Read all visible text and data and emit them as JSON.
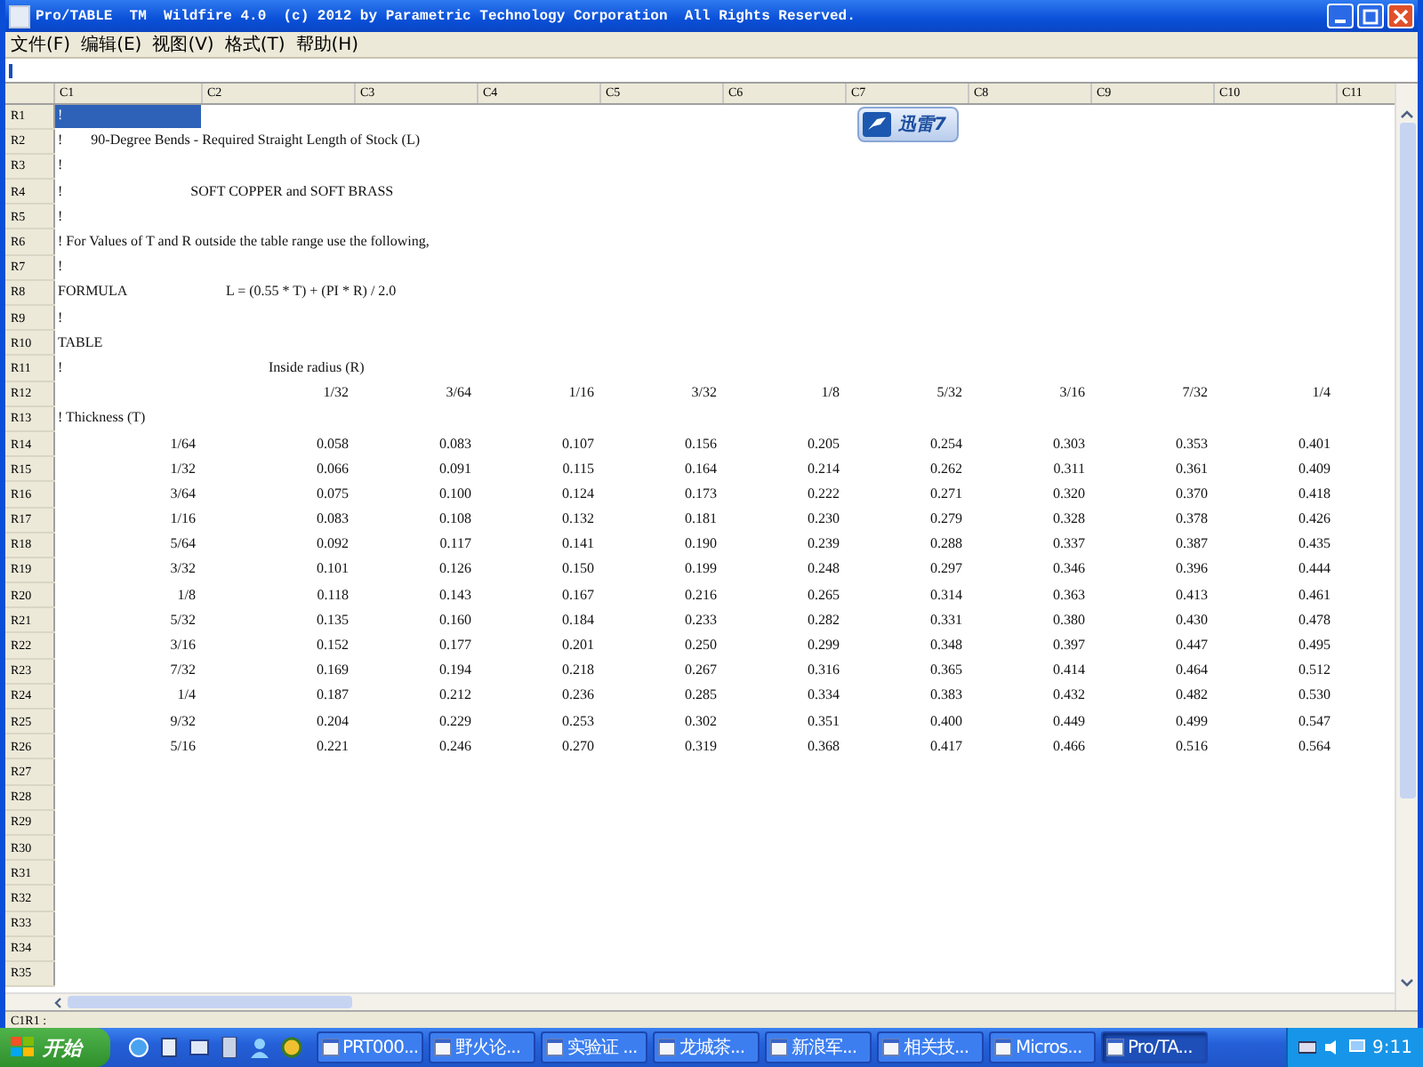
{
  "window": {
    "title": "Pro/TABLE  TM  Wildfire 4.0  (c) 2012 by Parametric Technology Corporation  All Rights Reserved."
  },
  "menu": [
    "文件(F)",
    "编辑(E)",
    "视图(V)",
    "格式(T)",
    "帮助(H)"
  ],
  "table": {
    "columns": [
      "C1",
      "C2",
      "C3",
      "C4",
      "C5",
      "C6",
      "C7",
      "C8",
      "C9",
      "C10",
      "C11"
    ],
    "rows": [
      {
        "label": "R1",
        "kind": "text",
        "selected": true,
        "cells": [
          "!"
        ]
      },
      {
        "label": "R2",
        "kind": "text",
        "selected": false,
        "cells": [
          "!        90-Degree Bends - Required Straight Length of Stock (L)"
        ]
      },
      {
        "label": "R3",
        "kind": "text",
        "selected": false,
        "cells": [
          "!"
        ]
      },
      {
        "label": "R4",
        "kind": "text",
        "selected": false,
        "cells": [
          "!                                    SOFT COPPER and SOFT BRASS"
        ]
      },
      {
        "label": "R5",
        "kind": "text",
        "selected": false,
        "cells": [
          "!"
        ]
      },
      {
        "label": "R6",
        "kind": "text",
        "selected": false,
        "cells": [
          "! For Values of T and R outside the table range use the following,"
        ]
      },
      {
        "label": "R7",
        "kind": "text",
        "selected": false,
        "cells": [
          "!"
        ]
      },
      {
        "label": "R8",
        "kind": "text",
        "selected": false,
        "cells": [
          "FORMULA",
          "      L = (0.55 * T) + (PI * R) / 2.0"
        ]
      },
      {
        "label": "R9",
        "kind": "text",
        "selected": false,
        "cells": [
          "!"
        ]
      },
      {
        "label": "R10",
        "kind": "text",
        "selected": false,
        "cells": [
          "TABLE"
        ]
      },
      {
        "label": "R11",
        "kind": "text",
        "selected": false,
        "cells": [
          "!",
          "                  Inside radius (R)"
        ]
      },
      {
        "label": "R12",
        "kind": "header",
        "selected": false,
        "cells": [
          "1/32",
          "3/64",
          "1/16",
          "3/32",
          "1/8",
          "5/32",
          "3/16",
          "7/32",
          "1/4"
        ]
      },
      {
        "label": "R13",
        "kind": "text",
        "selected": false,
        "cells": [
          "! Thickness (T)"
        ]
      },
      {
        "label": "R14",
        "kind": "data",
        "selected": false,
        "cells": [
          "1/64",
          "0.058",
          "0.083",
          "0.107",
          "0.156",
          "0.205",
          "0.254",
          "0.303",
          "0.353",
          "0.401"
        ]
      },
      {
        "label": "R15",
        "kind": "data",
        "selected": false,
        "cells": [
          "1/32",
          "0.066",
          "0.091",
          "0.115",
          "0.164",
          "0.214",
          "0.262",
          "0.311",
          "0.361",
          "0.409"
        ]
      },
      {
        "label": "R16",
        "kind": "data",
        "selected": false,
        "cells": [
          "3/64",
          "0.075",
          "0.100",
          "0.124",
          "0.173",
          "0.222",
          "0.271",
          "0.320",
          "0.370",
          "0.418"
        ]
      },
      {
        "label": "R17",
        "kind": "data",
        "selected": false,
        "cells": [
          "1/16",
          "0.083",
          "0.108",
          "0.132",
          "0.181",
          "0.230",
          "0.279",
          "0.328",
          "0.378",
          "0.426"
        ]
      },
      {
        "label": "R18",
        "kind": "data",
        "selected": false,
        "cells": [
          "5/64",
          "0.092",
          "0.117",
          "0.141",
          "0.190",
          "0.239",
          "0.288",
          "0.337",
          "0.387",
          "0.435"
        ]
      },
      {
        "label": "R19",
        "kind": "data",
        "selected": false,
        "cells": [
          "3/32",
          "0.101",
          "0.126",
          "0.150",
          "0.199",
          "0.248",
          "0.297",
          "0.346",
          "0.396",
          "0.444"
        ]
      },
      {
        "label": "R20",
        "kind": "data",
        "selected": false,
        "cells": [
          "1/8",
          "0.118",
          "0.143",
          "0.167",
          "0.216",
          "0.265",
          "0.314",
          "0.363",
          "0.413",
          "0.461"
        ]
      },
      {
        "label": "R21",
        "kind": "data",
        "selected": false,
        "cells": [
          "5/32",
          "0.135",
          "0.160",
          "0.184",
          "0.233",
          "0.282",
          "0.331",
          "0.380",
          "0.430",
          "0.478"
        ]
      },
      {
        "label": "R22",
        "kind": "data",
        "selected": false,
        "cells": [
          "3/16",
          "0.152",
          "0.177",
          "0.201",
          "0.250",
          "0.299",
          "0.348",
          "0.397",
          "0.447",
          "0.495"
        ]
      },
      {
        "label": "R23",
        "kind": "data",
        "selected": false,
        "cells": [
          "7/32",
          "0.169",
          "0.194",
          "0.218",
          "0.267",
          "0.316",
          "0.365",
          "0.414",
          "0.464",
          "0.512"
        ]
      },
      {
        "label": "R24",
        "kind": "data",
        "selected": false,
        "cells": [
          "1/4",
          "0.187",
          "0.212",
          "0.236",
          "0.285",
          "0.334",
          "0.383",
          "0.432",
          "0.482",
          "0.530"
        ]
      },
      {
        "label": "R25",
        "kind": "data",
        "selected": false,
        "cells": [
          "9/32",
          "0.204",
          "0.229",
          "0.253",
          "0.302",
          "0.351",
          "0.400",
          "0.449",
          "0.499",
          "0.547"
        ]
      },
      {
        "label": "R26",
        "kind": "data",
        "selected": false,
        "cells": [
          "5/16",
          "0.221",
          "0.246",
          "0.270",
          "0.319",
          "0.368",
          "0.417",
          "0.466",
          "0.516",
          "0.564"
        ]
      },
      {
        "label": "R27",
        "kind": "empty",
        "selected": false
      },
      {
        "label": "R28",
        "kind": "empty",
        "selected": false
      },
      {
        "label": "R29",
        "kind": "empty",
        "selected": false
      },
      {
        "label": "R30",
        "kind": "empty",
        "selected": false
      },
      {
        "label": "R31",
        "kind": "empty",
        "selected": false
      },
      {
        "label": "R32",
        "kind": "empty",
        "selected": false
      },
      {
        "label": "R33",
        "kind": "empty",
        "selected": false
      },
      {
        "label": "R34",
        "kind": "empty",
        "selected": false
      },
      {
        "label": "R35",
        "kind": "empty",
        "selected": false
      }
    ]
  },
  "floating_widget": {
    "label": "迅雷7"
  },
  "status_bar": {
    "text": "C1R1 :"
  },
  "taskbar": {
    "start": "开始",
    "tasks": [
      {
        "label": "PRT000...",
        "selected": false
      },
      {
        "label": "野火论...",
        "selected": false
      },
      {
        "label": "实验证 ...",
        "selected": false
      },
      {
        "label": "龙城茶...",
        "selected": false
      },
      {
        "label": "新浪军...",
        "selected": false
      },
      {
        "label": "相关技...",
        "selected": false
      },
      {
        "label": "Micros...",
        "selected": false
      },
      {
        "label": "Pro/TA...",
        "selected": true
      }
    ],
    "clock": "9:11"
  }
}
